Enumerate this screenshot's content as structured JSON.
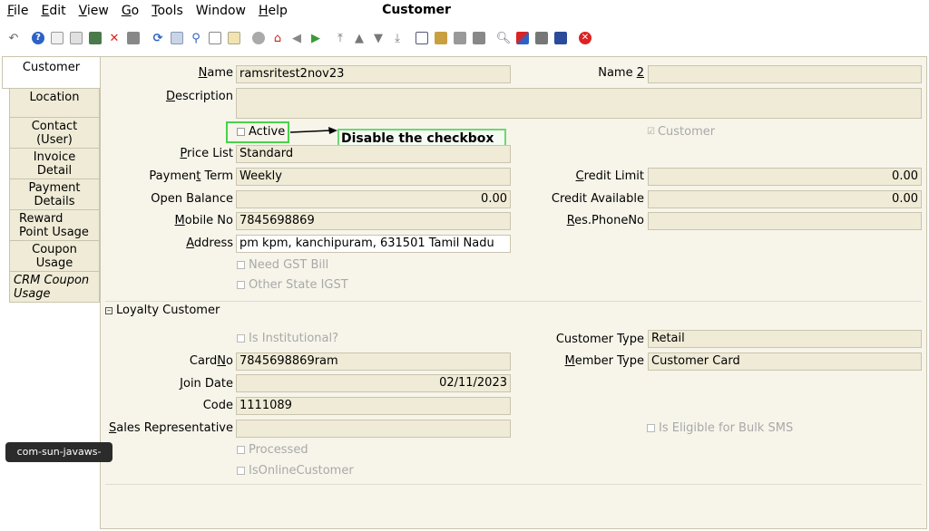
{
  "window": {
    "title": "Customer"
  },
  "menu": [
    {
      "pre": "",
      "u": "F",
      "post": "ile"
    },
    {
      "pre": "",
      "u": "E",
      "post": "dit"
    },
    {
      "pre": "",
      "u": "V",
      "post": "iew"
    },
    {
      "pre": "",
      "u": "G",
      "post": "o"
    },
    {
      "pre": "",
      "u": "T",
      "post": "ools"
    },
    {
      "pre": "",
      "u": "",
      "post": "Window"
    },
    {
      "pre": "",
      "u": "H",
      "post": "elp"
    }
  ],
  "tabs": [
    {
      "label": "Customer"
    },
    {
      "label": "Location"
    },
    {
      "label": "Contact (User)"
    },
    {
      "label": "Invoice Detail"
    },
    {
      "label": "Payment Details"
    },
    {
      "label": "Reward Point Usage"
    },
    {
      "label": "Coupon Usage"
    },
    {
      "label": "CRM Coupon Usage"
    }
  ],
  "form": {
    "name_label": "Name",
    "name_value": "ramsritest2nov23",
    "name2_label": "Name 2",
    "name2_value": "",
    "description_label": "Description",
    "description_value": "",
    "active_label": "Active",
    "customer_label": "Customer",
    "price_list_label": "Price List",
    "price_list_value": "Standard",
    "payment_term_label": "Payment Term",
    "payment_term_value": "Weekly",
    "credit_limit_label": "Credit Limit",
    "credit_limit_value": "0.00",
    "open_balance_label": "Open Balance",
    "open_balance_value": "0.00",
    "credit_available_label": "Credit Available",
    "credit_available_value": "0.00",
    "mobile_label": "Mobile No",
    "mobile_value": "7845698869",
    "res_phone_label": "Res.PhoneNo",
    "res_phone_value": "",
    "address_label": "Address",
    "address_value": "pm kpm, kanchipuram,  631501 Tamil Nadu",
    "need_gst_label": "Need GST Bill",
    "other_state_label": "Other State IGST"
  },
  "loyalty": {
    "header": "Loyalty Customer",
    "is_institutional_label": "Is Institutional?",
    "customer_type_label": "Customer Type",
    "customer_type_value": "Retail",
    "cardno_label": "CardNo",
    "cardno_value": "7845698869ram",
    "member_type_label": "Member Type",
    "member_type_value": "Customer Card",
    "join_date_label": "Join Date",
    "join_date_value": "02/11/2023",
    "code_label": "Code",
    "code_value": "1111089",
    "sales_rep_label": "Sales Representative",
    "sales_rep_value": "",
    "bulk_sms_label": "Is Eligible for Bulk SMS",
    "processed_label": "Processed",
    "online_label": "IsOnlineCustomer"
  },
  "annotation": {
    "text": "Disable the checkbox"
  },
  "tooltip": {
    "text": "com-sun-javaws-Main"
  },
  "colors": {
    "field_bg": "#efebd6",
    "panel_bg": "#f7f5ea",
    "highlight": "#4bd14b"
  }
}
